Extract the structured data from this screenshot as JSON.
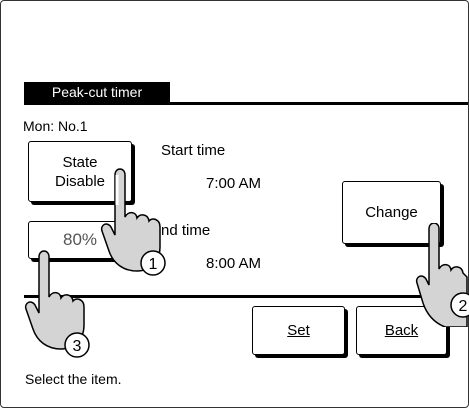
{
  "header": {
    "title": "Peak-cut timer"
  },
  "schedule": {
    "day_label": "Mon: No.1"
  },
  "state_button": {
    "line1": "State",
    "line2": "Disable"
  },
  "percent_button": {
    "label": "80%"
  },
  "start": {
    "label": "Start time",
    "value": "7:00  AM"
  },
  "end": {
    "label": "End time",
    "value": "8:00  AM"
  },
  "buttons": {
    "change": "Change",
    "set": "Set",
    "back": "Back"
  },
  "callouts": [
    "1",
    "2",
    "3"
  ],
  "status": {
    "message": "Select the item."
  },
  "icons": {
    "pointer": "pointing-hand-icon"
  }
}
